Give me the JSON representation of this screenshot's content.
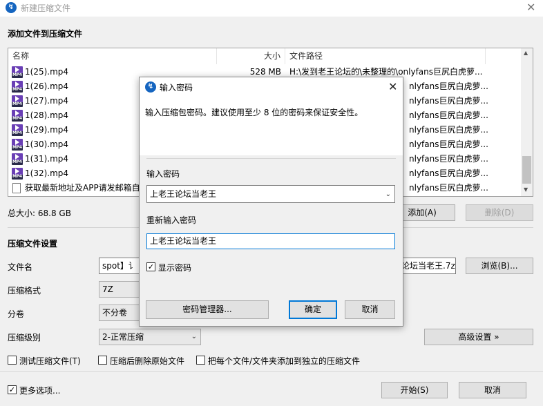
{
  "window": {
    "title": "新建压缩文件",
    "close_glyph": "✕",
    "app_icon_glyph": "↯"
  },
  "add_section": {
    "title": "添加文件到压缩文件"
  },
  "file_table": {
    "columns": [
      "名称",
      "大小",
      "文件路径"
    ],
    "rows": [
      {
        "name": "1(25).mp4",
        "size": "528 MB",
        "path": "H:\\发到老王论坛的\\未整理的\\onlyfans巨尻白虎萝..."
      },
      {
        "name": "1(26).mp4",
        "size": "",
        "path": "nlyfans巨尻白虎萝..."
      },
      {
        "name": "1(27).mp4",
        "size": "",
        "path": "nlyfans巨尻白虎萝..."
      },
      {
        "name": "1(28).mp4",
        "size": "",
        "path": "nlyfans巨尻白虎萝..."
      },
      {
        "name": "1(29).mp4",
        "size": "",
        "path": "nlyfans巨尻白虎萝..."
      },
      {
        "name": "1(30).mp4",
        "size": "",
        "path": "nlyfans巨尻白虎萝..."
      },
      {
        "name": "1(31).mp4",
        "size": "",
        "path": "nlyfans巨尻白虎萝..."
      },
      {
        "name": "1(32).mp4",
        "size": "",
        "path": "nlyfans巨尻白虎萝..."
      },
      {
        "name": "获取最新地址及APP请发邮箱自",
        "size": "",
        "path": "nlyfans巨尻白虎萝..."
      }
    ],
    "scroll_up": "▲",
    "scroll_down": "▼"
  },
  "total_size": "总大小: 68.8 GB",
  "buttons": {
    "add": "添加(A)",
    "delete": "删除(D)",
    "browse": "浏览(B)...",
    "advanced": "高级设置 »",
    "start": "开始(S)",
    "cancel": "取消"
  },
  "settings": {
    "title": "压缩文件设置",
    "filename_label": "文件名",
    "filename_value_left": "spot】讠",
    "filename_value_right": "论坛当老王.7z",
    "format_label": "压缩格式",
    "format_value": "7Z",
    "split_label": "分卷",
    "split_value": "不分卷",
    "level_label": "压缩级别",
    "level_value": "2-正常压缩"
  },
  "options": {
    "test": {
      "label": "测试压缩文件(T)",
      "checked": false
    },
    "delete_after": {
      "label": "压缩后删除原始文件",
      "checked": false
    },
    "separate": {
      "label": "把每个文件/文件夹添加到独立的压缩文件",
      "checked": false
    },
    "more": {
      "label": "更多选项...",
      "checked": true
    }
  },
  "dialog": {
    "title": "输入密码",
    "description": "输入压缩包密码。建议使用至少 8 位的密码来保证安全性。",
    "password_label": "输入密码",
    "password_value": "上老王论坛当老王",
    "confirm_label": "重新输入密码",
    "confirm_value": "上老王论坛当老王",
    "show_password": {
      "label": "显示密码",
      "checked": true
    },
    "buttons": {
      "manager": "密码管理器...",
      "ok": "确定",
      "cancel": "取消"
    }
  },
  "check_glyph": "✓",
  "combo_arrow": "⌄"
}
